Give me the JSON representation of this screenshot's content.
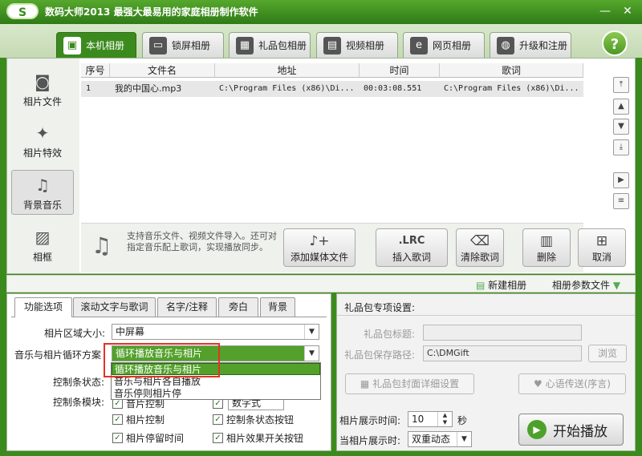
{
  "window": {
    "logo": "S",
    "title": "数码大师2013   最强大最易用的家庭相册制作软件",
    "minimize": "—",
    "close": "✕"
  },
  "tabs": [
    {
      "label": "本机相册",
      "icon": "user-photo-icon"
    },
    {
      "label": "锁屏相册",
      "icon": "monitor-icon"
    },
    {
      "label": "礼品包相册",
      "icon": "gift-icon"
    },
    {
      "label": "视频相册",
      "icon": "film-icon"
    },
    {
      "label": "网页相册",
      "icon": "ie-icon"
    },
    {
      "label": "升级和注册",
      "icon": "globe-icon"
    }
  ],
  "help": "?",
  "sidebar": [
    {
      "label": "相片文件",
      "icon": "camera-icon"
    },
    {
      "label": "相片特效",
      "icon": "effects-icon"
    },
    {
      "label": "背景音乐",
      "icon": "music-icon"
    },
    {
      "label": "相框",
      "icon": "frame-icon"
    }
  ],
  "table": {
    "headers": [
      "序号",
      "文件名",
      "地址",
      "时间",
      "歌词"
    ],
    "rows": [
      [
        "1",
        "我的中国心.mp3",
        "C:\\Program Files (x86)\\Di...",
        "00:03:08.551",
        "C:\\Program Files (x86)\\Di..."
      ]
    ]
  },
  "hint": "支持音乐文件、视频文件导入。还可对指定音乐配上歌词，实现播放同步。",
  "actions": {
    "add_media": "添加媒体文件",
    "insert_lyrics": "插入歌词",
    "lrc_icon": ".LRC",
    "clear_lyrics": "清除歌词",
    "delete": "删除",
    "cancel": "取消"
  },
  "strip": {
    "new_album": "新建相册",
    "params": "相册参数文件"
  },
  "subtabs": [
    "功能选项",
    "滚动文字与歌词",
    "名字/注释",
    "旁白",
    "背景"
  ],
  "options": {
    "area_label": "相片区域大小:",
    "area_value": "中屏幕",
    "loop_label": "音乐与相片循环方案",
    "loop_value": "循环播放音乐与相片",
    "loop_options": [
      "循环播放音乐与相片",
      "音乐与相片各自播放",
      "音乐停则相片停"
    ],
    "ctrl_status_label": "控制条状态:",
    "ctrl_module_label": "控制条模块:",
    "digital_partial": "数字式",
    "photo_ctrl_partial": "音片控制",
    "checks": [
      "相片控制",
      "控制条状态按钮",
      "相片停留时间",
      "相片效果开关按钮"
    ]
  },
  "gift": {
    "section_title": "礼品包专项设置:",
    "title_label": "礼品包标题:",
    "path_label": "礼品包保存路径:",
    "path_value": "C:\\DMGift",
    "browse": "浏览",
    "cover_btn": "礼品包封面详细设置",
    "msg_btn": "心语传送(序言)"
  },
  "display": {
    "time_label": "相片展示时间:",
    "time_value": "10",
    "unit": "秒",
    "mode_label": "当相片展示时:",
    "mode_value": "双重动态"
  },
  "play": "开始播放"
}
